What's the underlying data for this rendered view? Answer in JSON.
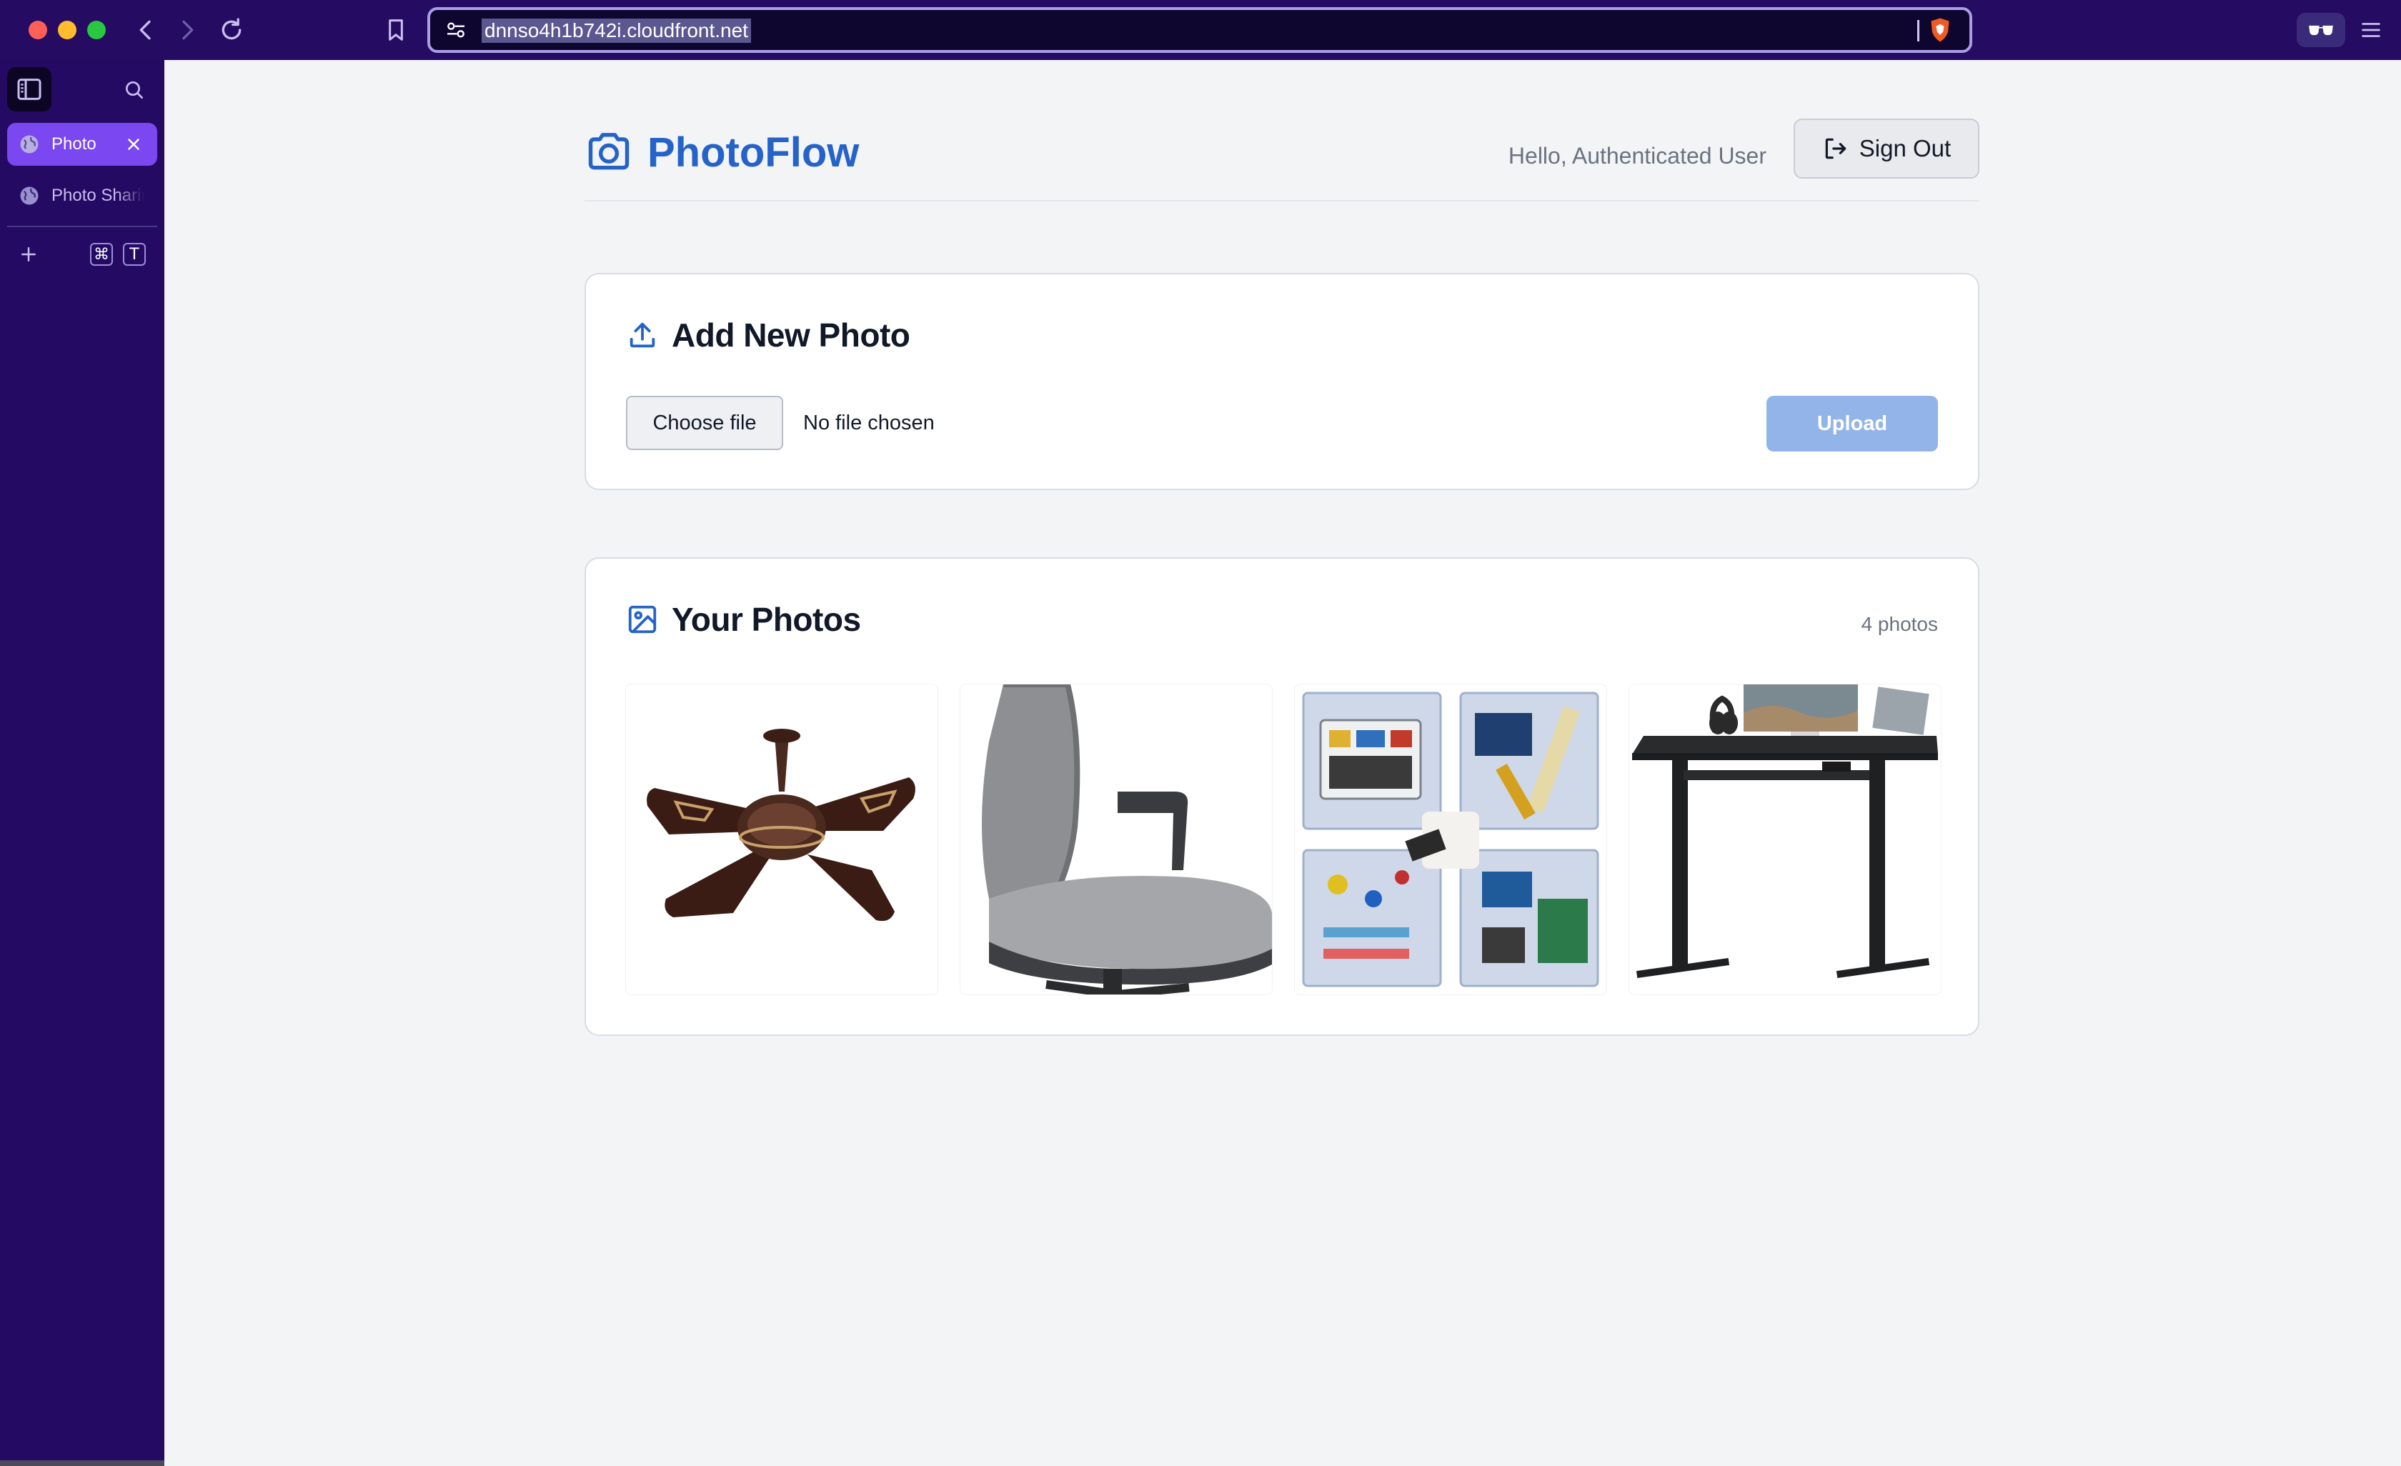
{
  "browser": {
    "url": "dnnso4h1b742i.cloudfront.net",
    "tabs": [
      {
        "label": "Photo",
        "active": true
      },
      {
        "label": "Photo Sharing",
        "active": false
      }
    ],
    "shortcut_keys": [
      "⌘",
      "T"
    ]
  },
  "app": {
    "name": "PhotoFlow",
    "greeting": "Hello, Authenticated User",
    "sign_out_label": "Sign Out",
    "brand_color": "#2563c9"
  },
  "upload": {
    "title": "Add New Photo",
    "choose_file_label": "Choose file",
    "file_status": "No file chosen",
    "upload_label": "Upload"
  },
  "gallery": {
    "title": "Your Photos",
    "count_label": "4 photos",
    "photos": [
      {
        "subject": "ceiling-fan"
      },
      {
        "subject": "office-chair"
      },
      {
        "subject": "electronics-kit"
      },
      {
        "subject": "standing-desk"
      }
    ]
  }
}
